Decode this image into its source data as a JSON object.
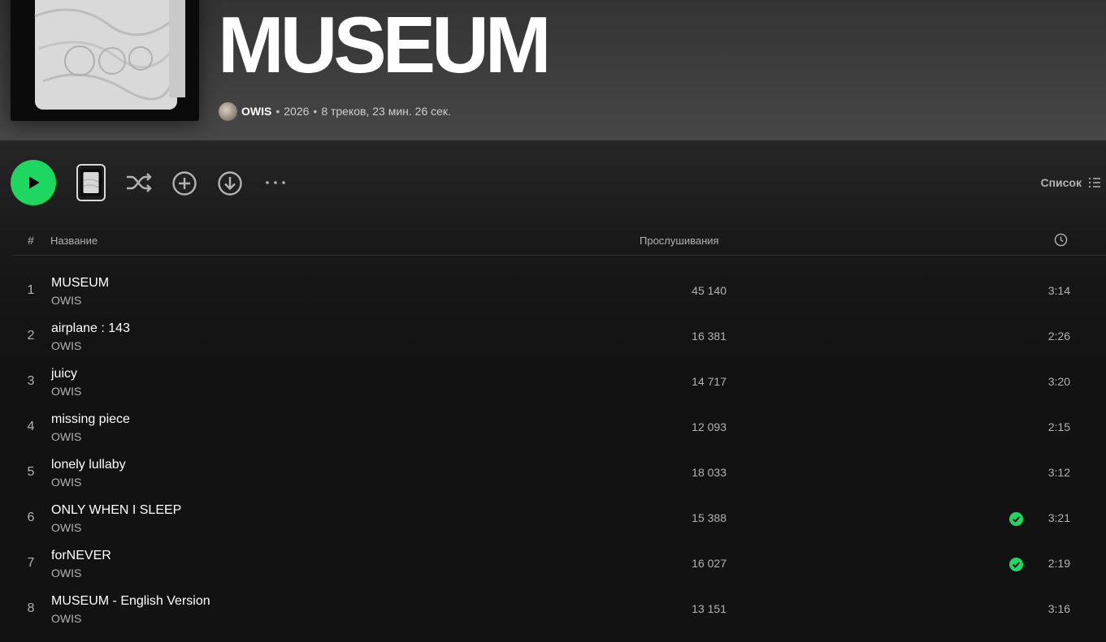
{
  "album": {
    "title": "MUSEUM",
    "artist": "OWIS",
    "year": "2026",
    "summary": "8 треков, 23 мин. 26 сек.",
    "separator": "•"
  },
  "actions": {
    "view_label": "Список",
    "more_label": "···"
  },
  "table": {
    "col_number": "#",
    "col_title": "Название",
    "col_plays": "Прослушивания"
  },
  "tracks": [
    {
      "number": "1",
      "title": "MUSEUM",
      "artist": "OWIS",
      "plays": "45 140",
      "duration": "3:14",
      "saved": false
    },
    {
      "number": "2",
      "title": "airplane : 143",
      "artist": "OWIS",
      "plays": "16 381",
      "duration": "2:26",
      "saved": false
    },
    {
      "number": "3",
      "title": "juicy",
      "artist": "OWIS",
      "plays": "14 717",
      "duration": "3:20",
      "saved": false
    },
    {
      "number": "4",
      "title": "missing piece",
      "artist": "OWIS",
      "plays": "12 093",
      "duration": "2:15",
      "saved": false
    },
    {
      "number": "5",
      "title": "lonely lullaby",
      "artist": "OWIS",
      "plays": "18 033",
      "duration": "3:12",
      "saved": false
    },
    {
      "number": "6",
      "title": "ONLY WHEN I SLEEP",
      "artist": "OWIS",
      "plays": "15 388",
      "duration": "3:21",
      "saved": true
    },
    {
      "number": "7",
      "title": "forNEVER",
      "artist": "OWIS",
      "plays": "16 027",
      "duration": "2:19",
      "saved": true
    },
    {
      "number": "8",
      "title": "MUSEUM - English Version",
      "artist": "OWIS",
      "plays": "13 151",
      "duration": "3:16",
      "saved": false
    }
  ],
  "icons": {
    "play": "play-icon",
    "shuffle": "shuffle-icon",
    "add": "plus-circle-icon",
    "download": "download-circle-icon",
    "more": "more-dots-icon",
    "list": "list-icon",
    "clock": "clock-icon",
    "saved": "check-circle-icon"
  },
  "colors": {
    "accent": "#1ed760",
    "background": "#121212",
    "text_primary": "#ffffff",
    "text_secondary": "#b3b3b3"
  }
}
